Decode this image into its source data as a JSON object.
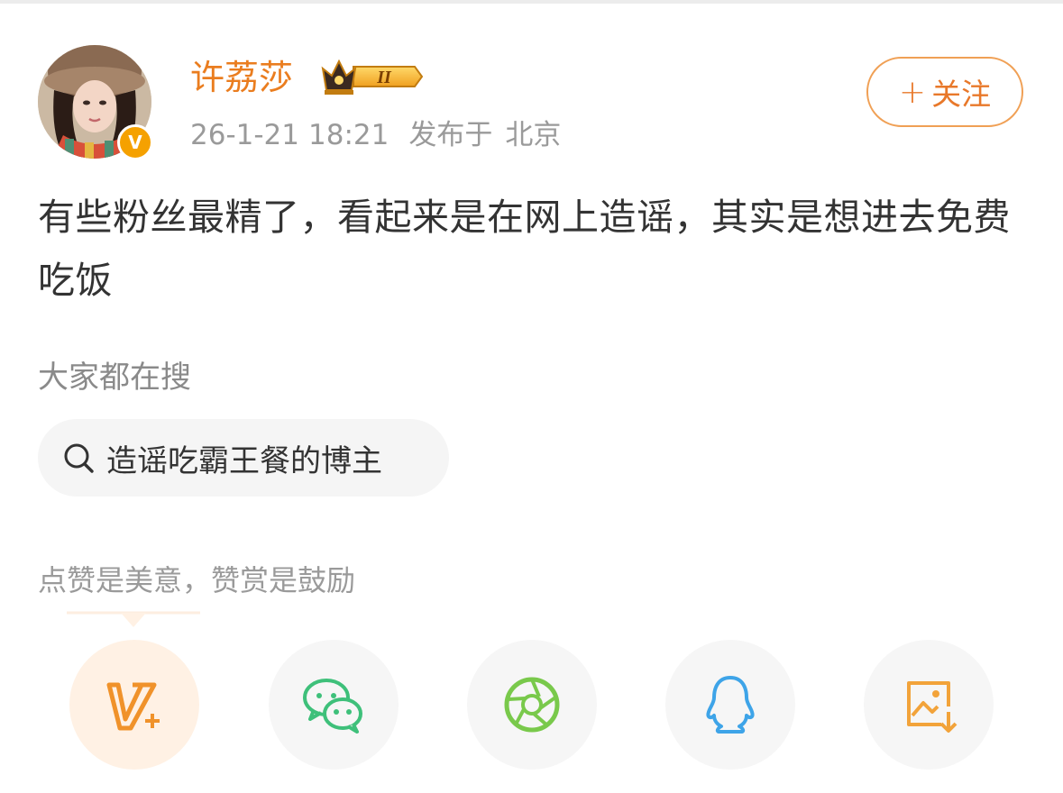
{
  "post": {
    "author": {
      "name": "许荔莎",
      "crown_level": "II",
      "verified_badge": "V"
    },
    "time": {
      "date": "26-1-21",
      "clock": "18:21"
    },
    "published_label": "发布于",
    "location": "北京",
    "follow_label": "关注",
    "text": "有些粉丝最精了，看起来是在网上造谣，其实是想进去免费吃饭"
  },
  "search": {
    "section_label": "大家都在搜",
    "chip_text": "造谣吃霸王餐的博主"
  },
  "reward": {
    "label": "点赞是美意，赞赏是鼓励"
  },
  "share_buttons": [
    {
      "icon": "v-plus-icon"
    },
    {
      "icon": "wechat-icon"
    },
    {
      "icon": "moments-icon"
    },
    {
      "icon": "qq-icon"
    },
    {
      "icon": "save-image-icon"
    }
  ],
  "colors": {
    "accent": "#ea7d1f",
    "follow_border": "#f0a055",
    "badge": "#f5a100",
    "wechat": "#3ec07a",
    "moments": "#79c94b",
    "qq": "#3ea4e8",
    "save": "#f2a33a"
  }
}
